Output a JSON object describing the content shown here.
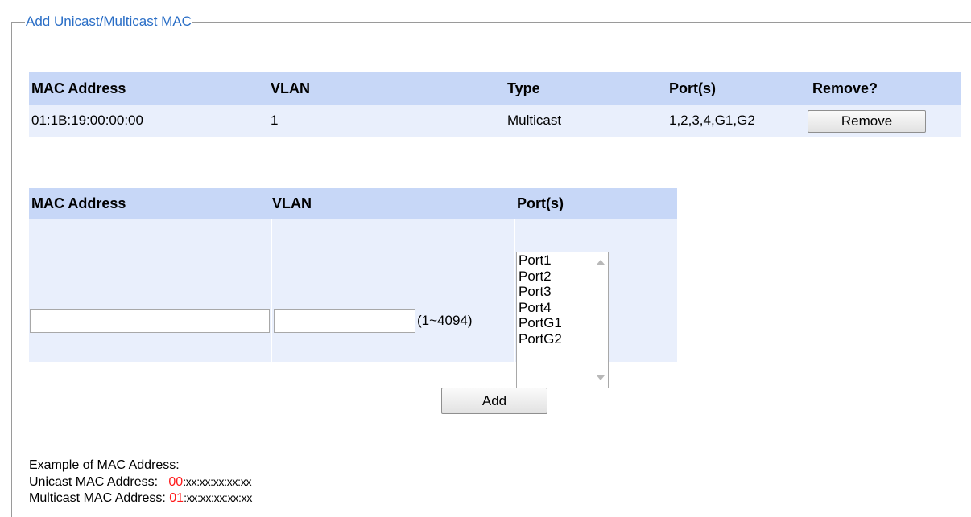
{
  "section": {
    "legend": "Add Unicast/Multicast MAC"
  },
  "existing_table": {
    "headers": [
      "MAC Address",
      "VLAN",
      "Type",
      "Port(s)",
      "Remove?"
    ],
    "rows": [
      {
        "mac": "01:1B:19:00:00:00",
        "vlan": "1",
        "type": "Multicast",
        "ports": "1,2,3,4,G1,G2",
        "remove_label": "Remove"
      }
    ]
  },
  "add_form": {
    "headers": [
      "MAC Address",
      "VLAN",
      "Port(s)"
    ],
    "mac_value": "",
    "vlan_value": "",
    "vlan_range": "(1~4094)",
    "port_options": [
      "Port1",
      "Port2",
      "Port3",
      "Port4",
      "PortG1",
      "PortG2"
    ],
    "add_label": "Add"
  },
  "example": {
    "title": "Example of MAC Address:",
    "unicast_label": "Unicast MAC Address:",
    "unicast_prefix": "00",
    "unicast_rest": ":xx:xx:xx:xx:xx",
    "multicast_label": "Multicast MAC Address:",
    "multicast_prefix": "01",
    "multicast_rest": ":xx:xx:xx:xx:xx"
  },
  "colors": {
    "legend": "#2a6ec6",
    "header_bg": "#c7d7f7",
    "row_bg": "#e9effc",
    "prefix_red": "#ff1a1a"
  }
}
